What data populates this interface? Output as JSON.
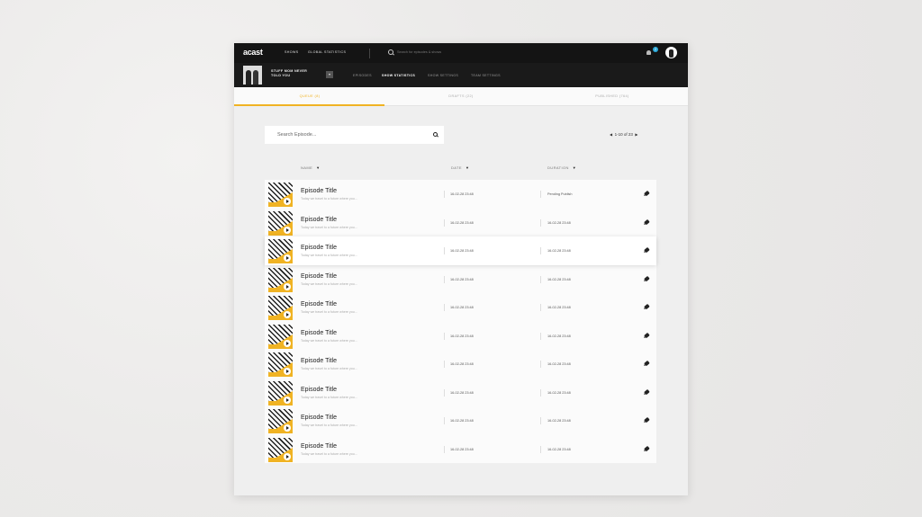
{
  "app": {
    "logo": "acast"
  },
  "topnav": {
    "links": [
      "SHOWS",
      "GLOBAL STATISTICS"
    ],
    "search_placeholder": "Search for episodes & shows",
    "notification_count": "2"
  },
  "show": {
    "title": "STUFF MOM NEVER TOLD YOU",
    "subnav": [
      "EPISODES",
      "SHOW STATISTICS",
      "SHOW SETTINGS",
      "TEAM SETTINGS"
    ],
    "active_subnav": "SHOW STATISTICS"
  },
  "tabs": [
    {
      "label": "QUEUE (8)",
      "active": true
    },
    {
      "label": "DRAFTS (22)",
      "active": false
    },
    {
      "label": "PUBLISHED (764)",
      "active": false
    }
  ],
  "episode_search": {
    "placeholder": "Search Episode..."
  },
  "pagination": {
    "text": "1-10 of 23"
  },
  "columns": [
    "NAME",
    "DATE",
    "DURATION"
  ],
  "episodes": [
    {
      "title": "Episode Title",
      "desc": "Today we travel to a future where you...",
      "date": "16-02-28 23:48",
      "duration": "Pending Publish"
    },
    {
      "title": "Episode Title",
      "desc": "Today we travel to a future where you...",
      "date": "16-02-28 23:48",
      "duration": "16-02-28 23:48"
    },
    {
      "title": "Episode Title",
      "desc": "Today we travel to a future where you...",
      "date": "16-02-28 23:48",
      "duration": "16-02-28 23:48"
    },
    {
      "title": "Episode Title",
      "desc": "Today we travel to a future where you...",
      "date": "16-02-28 23:48",
      "duration": "16-02-28 23:48"
    },
    {
      "title": "Episode Title",
      "desc": "Today we travel to a future where you...",
      "date": "16-02-28 23:48",
      "duration": "16-02-28 23:48"
    },
    {
      "title": "Episode Title",
      "desc": "Today we travel to a future where you...",
      "date": "16-02-28 23:48",
      "duration": "16-02-28 23:48"
    },
    {
      "title": "Episode Title",
      "desc": "Today we travel to a future where you...",
      "date": "16-02-28 23:48",
      "duration": "16-02-28 23:48"
    },
    {
      "title": "Episode Title",
      "desc": "Today we travel to a future where you...",
      "date": "16-02-28 23:48",
      "duration": "16-02-28 23:48"
    },
    {
      "title": "Episode Title",
      "desc": "Today we travel to a future where you...",
      "date": "16-02-28 23:48",
      "duration": "16-02-28 23:48"
    },
    {
      "title": "Episode Title",
      "desc": "Today we travel to a future where you...",
      "date": "16-02-28 23:48",
      "duration": "16-02-28 23:48"
    }
  ],
  "colors": {
    "accent": "#f0b323",
    "nav_bg": "#141414",
    "badge": "#2ba9d9"
  },
  "icons": [
    "search-icon",
    "bell-icon",
    "user-avatar",
    "chevron-down-icon",
    "play-icon",
    "edit-icon",
    "prev-arrow-icon",
    "next-arrow-icon"
  ]
}
